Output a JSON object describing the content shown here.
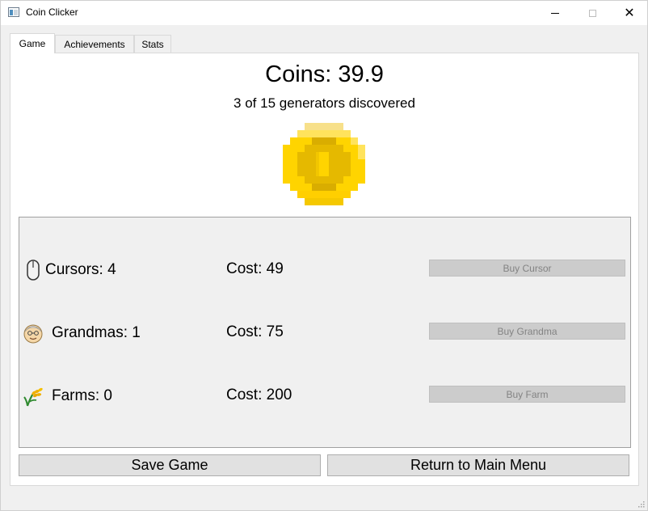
{
  "window": {
    "title": "Coin Clicker",
    "close_glyph": "✕"
  },
  "tabs": [
    {
      "label": "Game",
      "active": true
    },
    {
      "label": "Achievements",
      "active": false
    },
    {
      "label": "Stats",
      "active": false
    }
  ],
  "game": {
    "coins_text": "Coins: 39.9",
    "generators_text": "3 of 15 generators discovered",
    "coin_icon": "pixel-coin-icon",
    "coin_color": "#ffd400"
  },
  "generators": [
    {
      "name": "Cursors: 4",
      "cost": "Cost: 49",
      "button": "Buy Cursor",
      "icon": "mouse-icon",
      "enabled": false
    },
    {
      "name": "Grandmas: 1",
      "cost": "Cost: 75",
      "button": "Buy Grandma",
      "icon": "grandma-face-icon",
      "enabled": false
    },
    {
      "name": "Farms: 0",
      "cost": "Cost: 200",
      "button": "Buy Farm",
      "icon": "wheat-icon",
      "enabled": false
    }
  ],
  "actions": {
    "save_label": "Save Game",
    "menu_label": "Return to Main Menu"
  }
}
